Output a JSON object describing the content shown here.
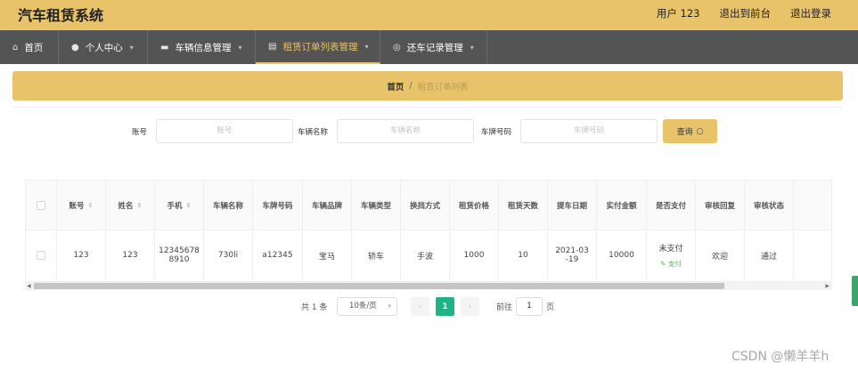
{
  "app": {
    "title": "汽车租赁系统"
  },
  "top_links": {
    "user": "用户 123",
    "front": "退出到前台",
    "logout": "退出登录"
  },
  "nav": [
    {
      "label": "首页",
      "icon": "home-icon"
    },
    {
      "label": "个人中心",
      "icon": "user-icon"
    },
    {
      "label": "车辆信息管理",
      "icon": "car-icon"
    },
    {
      "label": "租赁订单列表管理",
      "icon": "order-icon",
      "active": true
    },
    {
      "label": "还车记录管理",
      "icon": "return-icon"
    }
  ],
  "breadcrumb": {
    "home": "首页",
    "sep": "/",
    "current": "租赁订单列表"
  },
  "search": {
    "account_label": "账号",
    "account_placeholder": "账号",
    "car_name_label": "车辆名称",
    "car_name_placeholder": "车辆名称",
    "plate_label": "车牌号码",
    "plate_placeholder": "车牌号码",
    "button": "查询"
  },
  "table": {
    "columns": [
      "账号",
      "姓名",
      "手机",
      "车辆名称",
      "车牌号码",
      "车辆品牌",
      "车辆类型",
      "换挡方式",
      "租赁价格",
      "租赁天数",
      "提车日期",
      "实付金额",
      "是否支付",
      "审核回复",
      "审核状态"
    ],
    "rows": [
      {
        "account": "123",
        "name": "123",
        "phone_1": "12345678",
        "phone_2": "8910",
        "car_name": "730li",
        "plate": "a12345",
        "brand": "宝马",
        "type": "轿车",
        "gear": "手波",
        "price": "1000",
        "days": "10",
        "pickup_1": "2021-03",
        "pickup_2": "-19",
        "amount": "10000",
        "paid": "未支付",
        "pay_action": "支付",
        "reply": "欢迎",
        "status": "通过"
      }
    ]
  },
  "pagination": {
    "total": "共 1 条",
    "page_size": "10条/页",
    "current_page": "1",
    "goto_label": "前往",
    "goto_value": "1",
    "page_suffix": "页"
  },
  "watermark": "CSDN @懒羊羊h",
  "colors": {
    "accent": "#e8c36a",
    "nav_bg": "#545454",
    "page_active": "#1eb386"
  }
}
